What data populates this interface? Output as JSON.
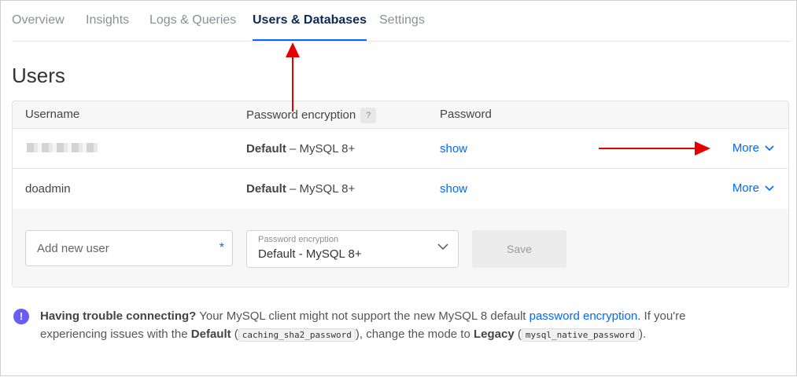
{
  "tabs": [
    {
      "label": "Overview",
      "active": false
    },
    {
      "label": "Insights",
      "active": false
    },
    {
      "label": "Logs & Queries",
      "active": false
    },
    {
      "label": "Users & Databases",
      "active": true
    },
    {
      "label": "Settings",
      "active": false
    }
  ],
  "page_title": "Users",
  "table": {
    "headers": {
      "username": "Username",
      "encryption": "Password encryption",
      "help": "?",
      "password": "Password"
    },
    "rows": [
      {
        "username": "",
        "encryption_mode": "Default",
        "encryption_detail": " – MySQL 8+",
        "password_action": "show",
        "more": "More"
      },
      {
        "username": "doadmin",
        "encryption_mode": "Default",
        "encryption_detail": " – MySQL 8+",
        "password_action": "show",
        "more": "More"
      }
    ]
  },
  "add_user": {
    "placeholder": "Add new user",
    "required_marker": "*",
    "encryption_label": "Password encryption",
    "encryption_value": "Default - MySQL 8+",
    "save_label": "Save"
  },
  "notice": {
    "icon": "info-icon",
    "title": "Having trouble connecting?",
    "text1": " Your MySQL client might not support the new MySQL 8 default ",
    "link": "password encryption",
    "text2": ". If you're experiencing issues with the ",
    "default_label": "Default",
    "text3": " (",
    "default_code": "caching_sha2_password",
    "text4": "), change the mode to ",
    "legacy_label": "Legacy",
    "text5": " (",
    "legacy_code": "mysql_native_password",
    "text6": ")."
  },
  "colors": {
    "accent": "#0069ff",
    "annotation": "#e60000",
    "notice_icon": "#6a5cf6"
  }
}
